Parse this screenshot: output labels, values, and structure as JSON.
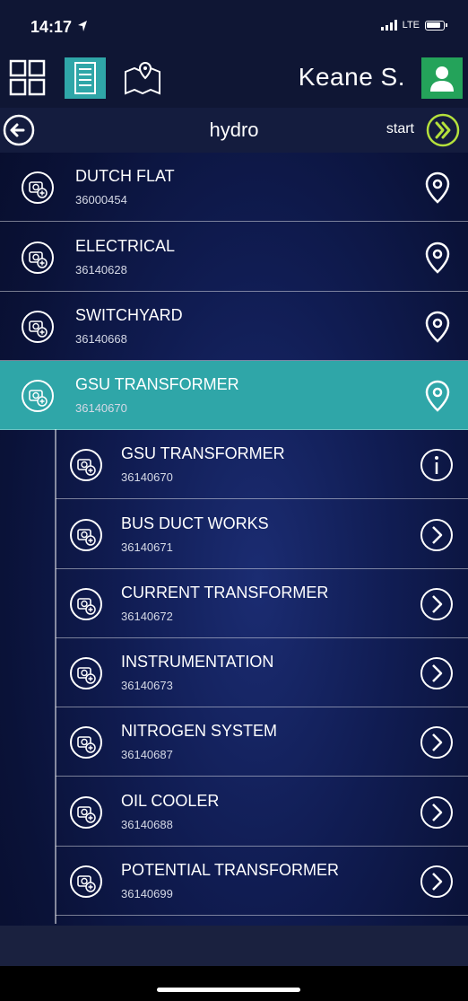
{
  "status": {
    "time": "14:17",
    "network": "LTE"
  },
  "toolbar": {
    "user_name": "Keane S.",
    "icons": [
      "grid-view-icon",
      "list-view-icon",
      "map-view-icon",
      "user-avatar-icon"
    ]
  },
  "nav": {
    "title": "hydro",
    "start_label": "start"
  },
  "colors": {
    "selected_row": "#2fa6a8",
    "avatar": "#24a35a",
    "start_accent": "#b4e03c",
    "background": "#0a1238"
  },
  "items": [
    {
      "name": "DUTCH FLAT",
      "code": "36000454",
      "action": "location-pin-icon"
    },
    {
      "name": "ELECTRICAL",
      "code": "36140628",
      "action": "location-pin-icon"
    },
    {
      "name": "SWITCHYARD",
      "code": "36140668",
      "action": "location-pin-icon"
    },
    {
      "name": "GSU TRANSFORMER",
      "code": "36140670",
      "action": "location-pin-icon",
      "selected": true
    }
  ],
  "children": [
    {
      "name": "GSU TRANSFORMER",
      "code": "36140670",
      "action": "info-icon"
    },
    {
      "name": "BUS DUCT WORKS",
      "code": "36140671",
      "action": "chevron-right-icon"
    },
    {
      "name": "CURRENT TRANSFORMER",
      "code": "36140672",
      "action": "chevron-right-icon"
    },
    {
      "name": "INSTRUMENTATION",
      "code": "36140673",
      "action": "chevron-right-icon"
    },
    {
      "name": "NITROGEN SYSTEM",
      "code": "36140687",
      "action": "chevron-right-icon"
    },
    {
      "name": "OIL COOLER",
      "code": "36140688",
      "action": "chevron-right-icon"
    },
    {
      "name": "POTENTIAL TRANSFORMER",
      "code": "36140699",
      "action": "chevron-right-icon"
    }
  ]
}
